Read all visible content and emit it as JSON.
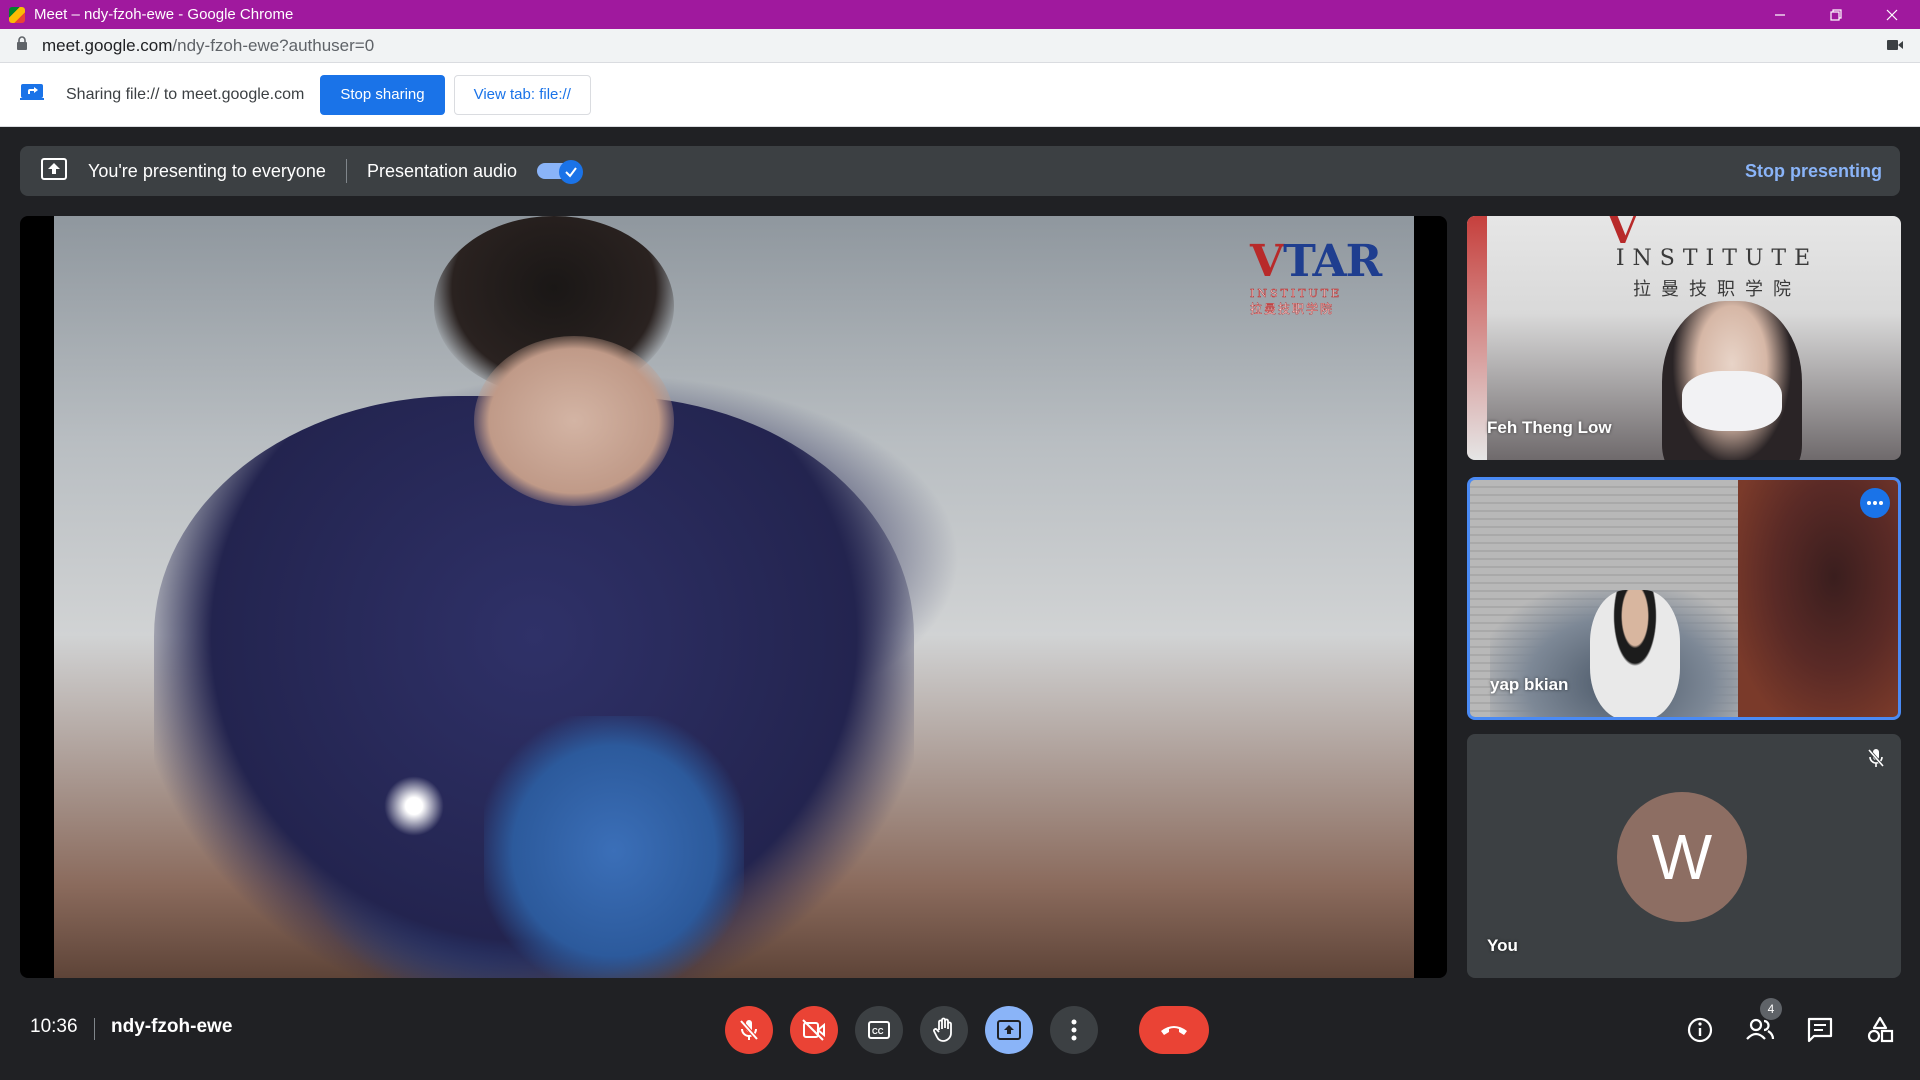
{
  "browser": {
    "window_title": "Meet – ndy-fzoh-ewe - Google Chrome",
    "url_host": "meet.google.com",
    "url_path": "/ndy-fzoh-ewe?authuser=0",
    "title_bar_color": "#a0199e"
  },
  "share_infobar": {
    "text": "Sharing file:// to meet.google.com",
    "stop_sharing_label": "Stop sharing",
    "view_tab_label": "View tab: file://"
  },
  "presentation_banner": {
    "text": "You're presenting to everyone",
    "audio_label": "Presentation audio",
    "audio_enabled": true,
    "stop_label": "Stop presenting"
  },
  "main_video": {
    "logo_mark_red": "V",
    "logo_mark_blue": "TAR",
    "logo_sub": "INSTITUTE",
    "logo_cn": "拉曼技职学院"
  },
  "participants": [
    {
      "name": "Feh Theng Low",
      "sign": "INSTITUTE",
      "sign_cn": "拉曼技职学院"
    },
    {
      "name": "yap bkian",
      "active_speaker": true
    },
    {
      "name": "You",
      "avatar_letter": "W",
      "muted": true
    }
  ],
  "bottom_bar": {
    "time": "10:36",
    "meeting_code": "ndy-fzoh-ewe",
    "participant_count": "4",
    "controls": [
      "mic-off-icon",
      "camera-off-icon",
      "captions-icon",
      "raise-hand-icon",
      "present-icon",
      "more-options-icon",
      "leave-call-icon"
    ],
    "right_controls": [
      "info-icon",
      "people-icon",
      "chat-icon",
      "activities-icon"
    ]
  },
  "colors": {
    "accent": "#1a73e8",
    "light_accent": "#8ab4f8",
    "danger": "#ea4335",
    "surface": "#202124",
    "tile": "#3c4043"
  }
}
